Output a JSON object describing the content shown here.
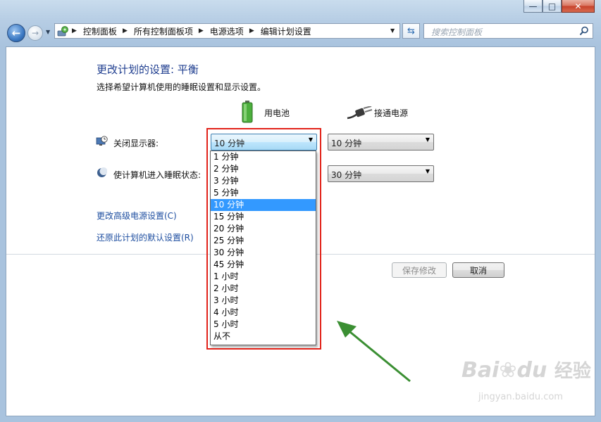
{
  "window": {
    "minimize_label": "—",
    "maximize_label": "□",
    "close_label": "✕"
  },
  "nav": {
    "back_icon": "back-arrow-icon",
    "forward_icon": "forward-arrow-icon"
  },
  "breadcrumb": [
    {
      "label": "控制面板"
    },
    {
      "label": "所有控制面板项"
    },
    {
      "label": "电源选项"
    },
    {
      "label": "编辑计划设置"
    }
  ],
  "search": {
    "placeholder": "搜索控制面板"
  },
  "page": {
    "title": "更改计划的设置: 平衡",
    "subtitle": "选择希望计算机使用的睡眠设置和显示设置。",
    "col_battery": "用电池",
    "col_plugged": "接通电源",
    "display_label": "关闭显示器:",
    "sleep_label": "使计算机进入睡眠状态:",
    "display_battery_value": "10 分钟",
    "display_plugged_value": "10 分钟",
    "sleep_plugged_value": "30 分钟",
    "advanced_link": "更改高级电源设置(C)",
    "restore_link": "还原此计划的默认设置(R)",
    "save_button": "保存修改",
    "cancel_button": "取消"
  },
  "dropdown": {
    "options": [
      "1 分钟",
      "2 分钟",
      "3 分钟",
      "5 分钟",
      "10 分钟",
      "15 分钟",
      "20 分钟",
      "25 分钟",
      "30 分钟",
      "45 分钟",
      "1 小时",
      "2 小时",
      "3 小时",
      "4 小时",
      "5 小时",
      "从不"
    ],
    "selected": "10 分钟"
  },
  "watermark": {
    "brand": "Bai",
    "brand2": "du",
    "suffix": "经验",
    "url": "jingyan.baidu.com"
  },
  "colors": {
    "link": "#1e4ea0",
    "title": "#1e3d8f",
    "highlight": "#e2231a",
    "selection": "#3399ff",
    "arrow": "#3b8f33"
  }
}
